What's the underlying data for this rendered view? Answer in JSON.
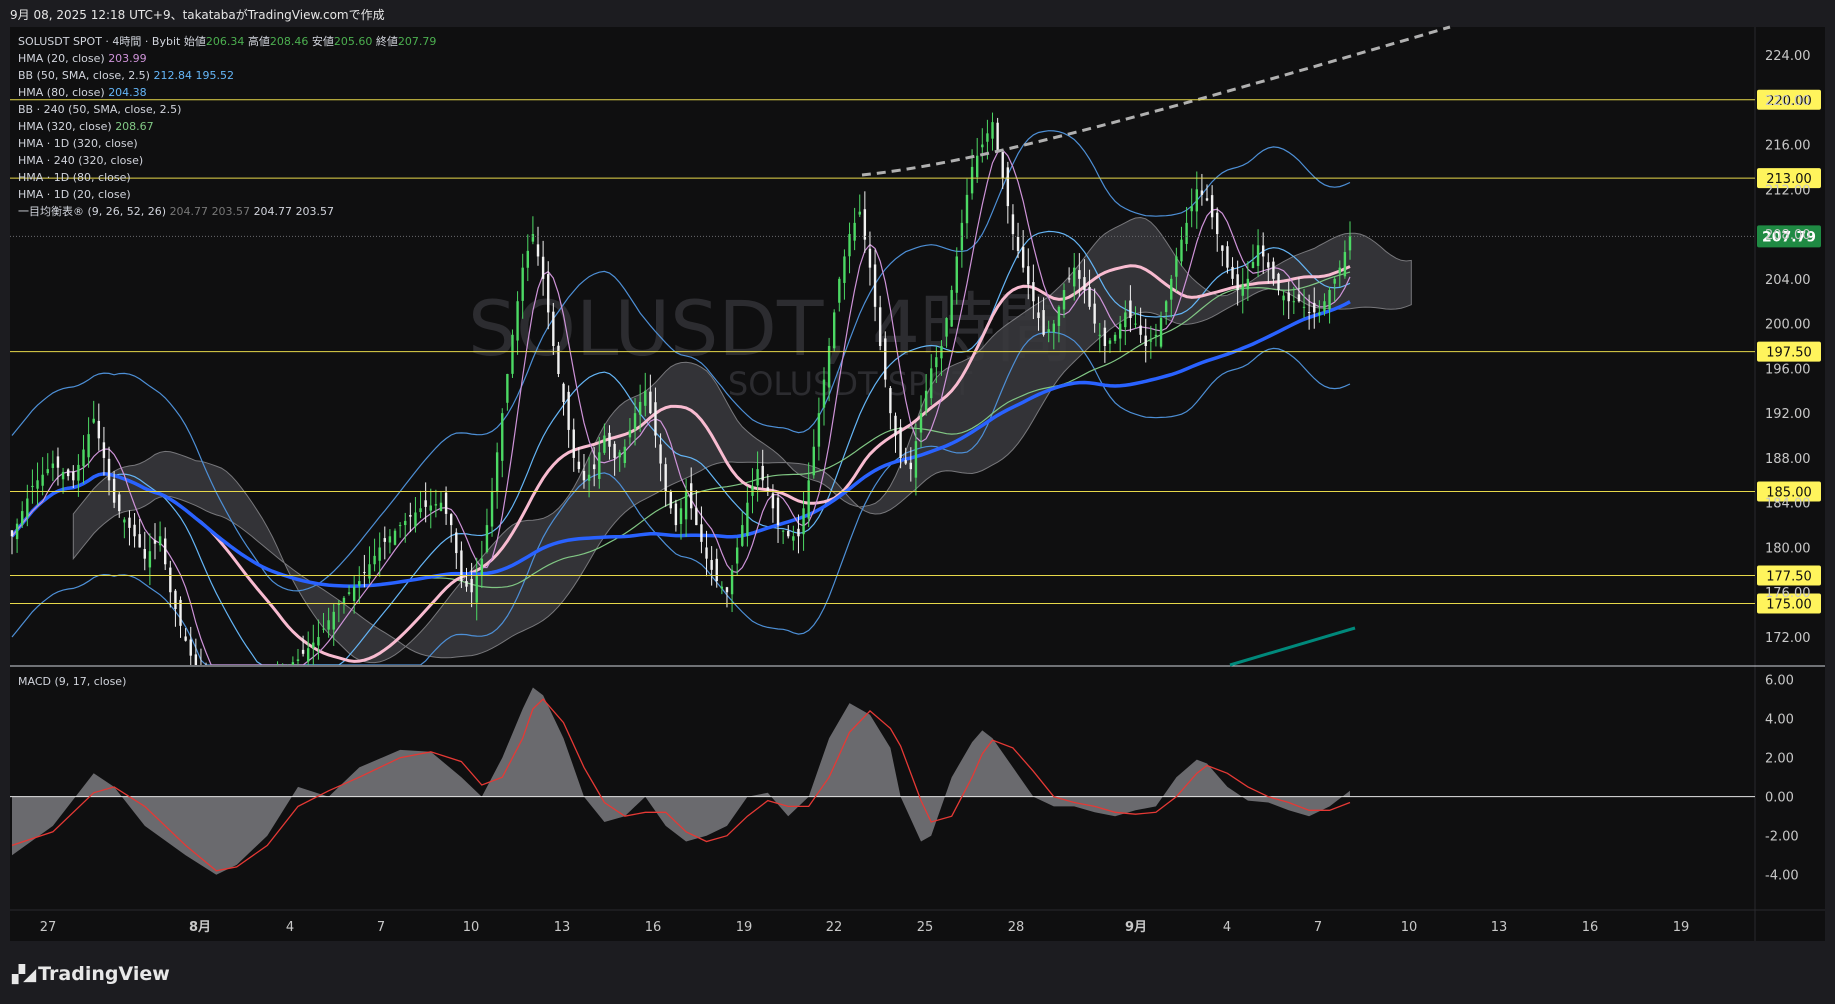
{
  "header": "9月 08, 2025 12:18 UTC+9、takatabaがTradingView.comで作成",
  "watermark": {
    "main": "SOLUSDT, 4時間",
    "sub": "SOLUSDT SPOT"
  },
  "legend": {
    "symbol_line": "SOLUSDT SPOT · 4時間 · Bybit",
    "open_label": "始値",
    "open": "206.34",
    "high_label": "高値",
    "high": "208.46",
    "low_label": "安値",
    "low": "205.60",
    "close_label": "終値",
    "close": "207.79",
    "indicators": [
      {
        "name": "HMA (20, close)",
        "value": "203.99",
        "color": "#ce93d8"
      },
      {
        "name": "BB (50, SMA, close, 2.5)",
        "value": "212.84  195.52",
        "color": "#64b5f6"
      },
      {
        "name": "HMA (80, close)",
        "value": "204.38",
        "color": "#64b5f6"
      },
      {
        "name": "BB · 240 (50, SMA, close, 2.5)",
        "value": "",
        "color": ""
      },
      {
        "name": "HMA (320, close)",
        "value": "208.67",
        "color": "#81c784"
      },
      {
        "name": "HMA · 1D (320, close)",
        "value": "",
        "color": ""
      },
      {
        "name": "HMA · 240 (320, close)",
        "value": "",
        "color": ""
      },
      {
        "name": "HMA · 1D (80, close)",
        "value": "",
        "color": ""
      },
      {
        "name": "HMA · 1D (20, close)",
        "value": "",
        "color": ""
      }
    ],
    "ichimoku_name": "一目均衡表® (9, 26, 52, 26)",
    "ichimoku_values": [
      "204.77",
      "203.57",
      "204.77",
      "203.57"
    ]
  },
  "macd_label": "MACD (9, 17, close)",
  "logo_text": "TradingView",
  "chart_data": [
    {
      "type": "candlestick",
      "title": "SOLUSDT SPOT · 4時間 · Bybit",
      "x_ticks": [
        "27",
        "8月",
        "4",
        "7",
        "10",
        "13",
        "16",
        "19",
        "22",
        "25",
        "28",
        "9月",
        "4",
        "7",
        "10",
        "13",
        "16",
        "19"
      ],
      "y_ticks": [
        172,
        176,
        180,
        184,
        188,
        192,
        196,
        200,
        204,
        208,
        212,
        216,
        220,
        224
      ],
      "ylim": [
        169.5,
        226.5
      ],
      "horizontal_levels": [
        220.0,
        213.0,
        197.5,
        185.0,
        177.5,
        175.0
      ],
      "level_labels": [
        "220.00",
        "213.00",
        "197.50",
        "185.00",
        "177.50",
        "175.00"
      ],
      "last_price": 207.79,
      "last_price_label": "207.79",
      "close_path": [
        [
          0,
          181
        ],
        [
          2,
          185.5
        ],
        [
          4,
          187.5
        ],
        [
          6,
          186
        ],
        [
          8,
          191.5
        ],
        [
          9,
          188
        ],
        [
          10,
          184
        ],
        [
          12,
          181
        ],
        [
          13,
          179
        ],
        [
          14.5,
          181
        ],
        [
          15.5,
          176
        ],
        [
          16.5,
          173
        ],
        [
          18,
          169
        ],
        [
          20,
          166
        ],
        [
          22,
          165
        ],
        [
          24,
          165.5
        ],
        [
          26,
          169
        ],
        [
          28,
          170
        ],
        [
          30,
          172
        ],
        [
          32,
          175
        ],
        [
          34,
          177
        ],
        [
          36,
          180
        ],
        [
          38,
          182
        ],
        [
          40,
          183.5
        ],
        [
          42,
          184
        ],
        [
          43,
          182
        ],
        [
          44,
          177
        ],
        [
          45,
          176
        ],
        [
          46,
          179
        ],
        [
          47,
          185
        ],
        [
          48,
          192
        ],
        [
          49,
          199
        ],
        [
          50,
          205
        ],
        [
          51,
          208
        ],
        [
          52,
          204
        ],
        [
          53,
          198
        ],
        [
          54,
          193
        ],
        [
          55,
          188
        ],
        [
          56,
          186
        ],
        [
          57,
          187
        ],
        [
          58,
          190
        ],
        [
          59,
          188
        ],
        [
          60,
          189
        ],
        [
          61,
          192
        ],
        [
          62,
          194
        ],
        [
          63,
          190
        ],
        [
          64,
          185
        ],
        [
          65,
          182
        ],
        [
          66,
          185
        ],
        [
          67,
          182
        ],
        [
          68,
          179
        ],
        [
          69,
          177
        ],
        [
          70,
          176
        ],
        [
          71,
          180
        ],
        [
          72,
          184
        ],
        [
          73,
          187
        ],
        [
          74,
          185
        ],
        [
          75,
          182
        ],
        [
          76,
          181
        ],
        [
          77,
          181
        ],
        [
          78,
          186
        ],
        [
          79,
          192
        ],
        [
          80,
          198
        ],
        [
          81,
          204
        ],
        [
          82,
          208
        ],
        [
          83,
          210
        ],
        [
          84,
          205
        ],
        [
          85,
          198
        ],
        [
          86,
          192
        ],
        [
          87,
          188
        ],
        [
          88,
          187
        ],
        [
          89,
          192
        ],
        [
          90,
          196
        ],
        [
          91,
          198
        ],
        [
          92,
          203
        ],
        [
          93,
          209
        ],
        [
          94,
          214
        ],
        [
          95,
          216
        ],
        [
          96,
          218
        ],
        [
          97,
          213
        ],
        [
          98,
          208
        ],
        [
          99,
          205
        ],
        [
          100,
          202
        ],
        [
          101,
          199
        ],
        [
          102,
          200
        ],
        [
          103,
          203
        ],
        [
          104,
          205
        ],
        [
          105,
          203
        ],
        [
          106,
          200
        ],
        [
          107,
          198
        ],
        [
          108,
          199
        ],
        [
          109,
          201
        ],
        [
          110,
          200
        ],
        [
          111,
          198
        ],
        [
          112,
          199
        ],
        [
          113,
          202
        ],
        [
          114,
          206
        ],
        [
          115,
          209
        ],
        [
          116,
          212
        ],
        [
          117,
          211
        ],
        [
          118,
          208
        ],
        [
          119,
          205
        ],
        [
          120,
          203
        ],
        [
          121,
          204
        ],
        [
          122,
          207
        ],
        [
          123,
          205
        ],
        [
          124,
          203
        ],
        [
          125,
          202
        ],
        [
          126,
          202
        ],
        [
          127,
          201
        ],
        [
          128,
          201
        ],
        [
          129,
          203
        ],
        [
          130,
          205
        ],
        [
          131,
          207.79
        ]
      ]
    },
    {
      "type": "area",
      "title": "MACD (9, 17, close)",
      "y_ticks": [
        -4.0,
        -2.0,
        0.0,
        2.0,
        4.0,
        6.0
      ],
      "y_tick_labels": [
        "-4.00",
        "-2.00",
        "0.00",
        "2.00",
        "4.00",
        "6.00"
      ],
      "ylim": [
        -5.3,
        6.6
      ],
      "macd": [
        [
          0,
          -3
        ],
        [
          4,
          -1.5
        ],
        [
          8,
          1.2
        ],
        [
          10,
          0.5
        ],
        [
          13,
          -1.5
        ],
        [
          17,
          -3
        ],
        [
          20,
          -4
        ],
        [
          22,
          -3.5
        ],
        [
          25,
          -2
        ],
        [
          28,
          0.5
        ],
        [
          31,
          0
        ],
        [
          34,
          1.5
        ],
        [
          38,
          2.4
        ],
        [
          41,
          2.3
        ],
        [
          44,
          1
        ],
        [
          46,
          0
        ],
        [
          48,
          2
        ],
        [
          50,
          4.5
        ],
        [
          51,
          5.6
        ],
        [
          52,
          5.2
        ],
        [
          54,
          3
        ],
        [
          56,
          0
        ],
        [
          58,
          -1.3
        ],
        [
          60,
          -1
        ],
        [
          62,
          0
        ],
        [
          64,
          -1.5
        ],
        [
          66,
          -2.3
        ],
        [
          68,
          -2
        ],
        [
          70,
          -1.5
        ],
        [
          72,
          0
        ],
        [
          74,
          0.2
        ],
        [
          76,
          -1
        ],
        [
          78,
          0
        ],
        [
          80,
          3
        ],
        [
          82,
          4.8
        ],
        [
          84,
          4.2
        ],
        [
          86,
          2.5
        ],
        [
          87,
          0
        ],
        [
          89,
          -2.3
        ],
        [
          90,
          -2
        ],
        [
          92,
          1
        ],
        [
          94,
          2.8
        ],
        [
          95,
          3.4
        ],
        [
          96,
          3
        ],
        [
          98,
          1.5
        ],
        [
          100,
          0
        ],
        [
          102,
          -0.5
        ],
        [
          104,
          -0.5
        ],
        [
          106,
          -0.8
        ],
        [
          108,
          -1
        ],
        [
          110,
          -0.7
        ],
        [
          112,
          -0.5
        ],
        [
          114,
          1
        ],
        [
          116,
          1.9
        ],
        [
          117,
          1.7
        ],
        [
          119,
          0.5
        ],
        [
          121,
          -0.2
        ],
        [
          123,
          -0.3
        ],
        [
          125,
          -0.7
        ],
        [
          127,
          -1
        ],
        [
          129,
          -0.5
        ],
        [
          131,
          0.3
        ]
      ],
      "signal": [
        [
          0,
          -2.5
        ],
        [
          4,
          -1.8
        ],
        [
          8,
          0.2
        ],
        [
          10,
          0.5
        ],
        [
          13,
          -0.5
        ],
        [
          17,
          -2.5
        ],
        [
          20,
          -3.8
        ],
        [
          22,
          -3.6
        ],
        [
          25,
          -2.5
        ],
        [
          28,
          -0.5
        ],
        [
          31,
          0.3
        ],
        [
          34,
          1
        ],
        [
          38,
          2
        ],
        [
          41,
          2.3
        ],
        [
          44,
          1.8
        ],
        [
          46,
          0.6
        ],
        [
          48,
          1
        ],
        [
          50,
          3
        ],
        [
          51,
          4.5
        ],
        [
          52,
          5
        ],
        [
          54,
          3.8
        ],
        [
          56,
          1.5
        ],
        [
          58,
          -0.3
        ],
        [
          60,
          -1
        ],
        [
          62,
          -0.8
        ],
        [
          64,
          -0.8
        ],
        [
          66,
          -1.8
        ],
        [
          68,
          -2.3
        ],
        [
          70,
          -2
        ],
        [
          72,
          -1
        ],
        [
          74,
          -0.2
        ],
        [
          76,
          -0.5
        ],
        [
          78,
          -0.5
        ],
        [
          80,
          1
        ],
        [
          82,
          3.3
        ],
        [
          84,
          4.4
        ],
        [
          86,
          3.5
        ],
        [
          87,
          2.6
        ],
        [
          89,
          -0.2
        ],
        [
          90,
          -1.3
        ],
        [
          92,
          -1
        ],
        [
          94,
          1
        ],
        [
          95,
          2.2
        ],
        [
          96,
          2.9
        ],
        [
          98,
          2.5
        ],
        [
          100,
          1.3
        ],
        [
          102,
          0
        ],
        [
          104,
          -0.3
        ],
        [
          106,
          -0.5
        ],
        [
          108,
          -0.8
        ],
        [
          110,
          -0.9
        ],
        [
          112,
          -0.8
        ],
        [
          114,
          0
        ],
        [
          116,
          1.2
        ],
        [
          117,
          1.6
        ],
        [
          119,
          1.2
        ],
        [
          121,
          0.5
        ],
        [
          123,
          0
        ],
        [
          125,
          -0.3
        ],
        [
          127,
          -0.7
        ],
        [
          129,
          -0.7
        ],
        [
          131,
          -0.3
        ]
      ]
    }
  ]
}
